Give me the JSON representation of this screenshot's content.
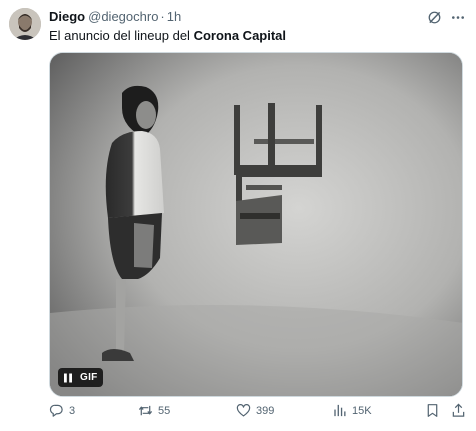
{
  "tweet": {
    "author_name": "Diego",
    "author_handle": "@diegochro",
    "separator": "·",
    "time": "1h",
    "text_prefix": "El anuncio del lineup del ",
    "text_bold": "Corona Capital"
  },
  "media": {
    "badge_label": "GIF",
    "pause_icon": "pause-icon"
  },
  "actions": {
    "reply_count": "3",
    "retweet_count": "55",
    "like_count": "399",
    "views_count": "15K"
  },
  "icons": {
    "grok": "grok-icon",
    "more": "more-icon",
    "reply": "reply-icon",
    "retweet": "retweet-icon",
    "like": "heart-icon",
    "views": "views-icon",
    "bookmark": "bookmark-icon",
    "share": "share-icon"
  }
}
